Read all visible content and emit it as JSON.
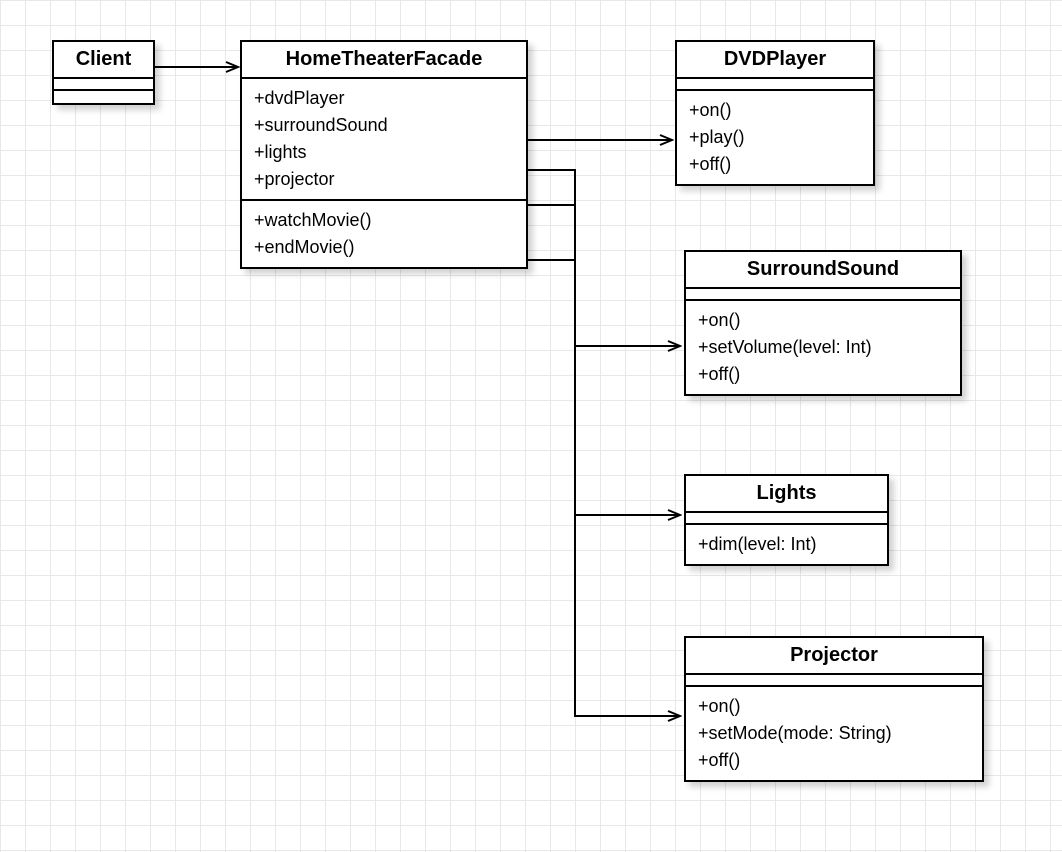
{
  "classes": {
    "client": {
      "name": "Client",
      "attributes": [],
      "methods": []
    },
    "facade": {
      "name": "HomeTheaterFacade",
      "attributes": [
        "+dvdPlayer",
        "+surroundSound",
        "+lights",
        "+projector"
      ],
      "methods": [
        "+watchMovie()",
        "+endMovie()"
      ]
    },
    "dvd": {
      "name": "DVDPlayer",
      "attributes": [],
      "methods": [
        "+on()",
        "+play()",
        "+off()"
      ]
    },
    "surround": {
      "name": "SurroundSound",
      "attributes": [],
      "methods": [
        "+on()",
        "+setVolume(level: Int)",
        "+off()"
      ]
    },
    "lights": {
      "name": "Lights",
      "attributes": [],
      "methods": [
        "+dim(level: Int)"
      ]
    },
    "projector": {
      "name": "Projector",
      "attributes": [],
      "methods": [
        "+on()",
        "+setMode(mode: String)",
        "+off()"
      ]
    }
  }
}
